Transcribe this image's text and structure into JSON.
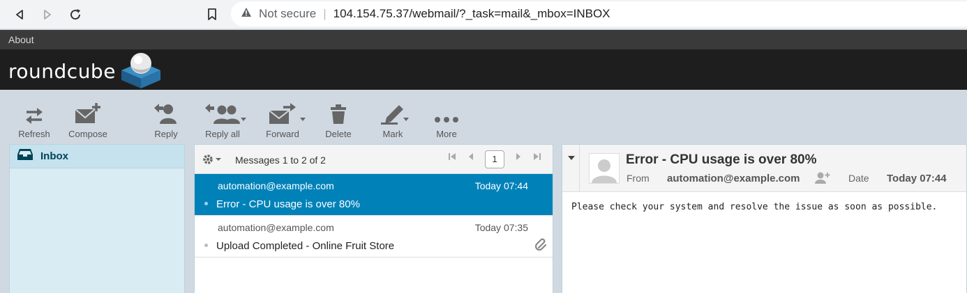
{
  "browser": {
    "security_label": "Not secure",
    "url": "104.154.75.37/webmail/?_task=mail&_mbox=INBOX"
  },
  "topbar": {
    "about_label": "About"
  },
  "header": {
    "logo_text": "roundcube"
  },
  "toolbar": {
    "refresh": "Refresh",
    "compose": "Compose",
    "reply": "Reply",
    "reply_all": "Reply all",
    "forward": "Forward",
    "delete": "Delete",
    "mark": "Mark",
    "more": "More"
  },
  "folders": [
    {
      "name": "Inbox",
      "icon": "inbox-icon",
      "selected": true
    }
  ],
  "message_list": {
    "count_text": "Messages 1 to 2 of 2",
    "page": "1",
    "messages": [
      {
        "from": "automation@example.com",
        "date": "Today 07:44",
        "subject": "Error - CPU usage is over 80%",
        "selected": true,
        "attachment": false
      },
      {
        "from": "automation@example.com",
        "date": "Today 07:35",
        "subject": "Upload Completed - Online Fruit Store",
        "selected": false,
        "attachment": true
      }
    ]
  },
  "preview": {
    "subject": "Error - CPU usage is over 80%",
    "from_label": "From",
    "from_value": "automation@example.com",
    "date_label": "Date",
    "date_value": "Today 07:44",
    "body": "Please check your system and resolve the issue as soon as possible."
  },
  "colors": {
    "accent": "#0082b9",
    "header_bg": "#1e1e1e",
    "toolbar_bg": "#d0d9e1",
    "folder_bg": "#d9ecf4"
  }
}
